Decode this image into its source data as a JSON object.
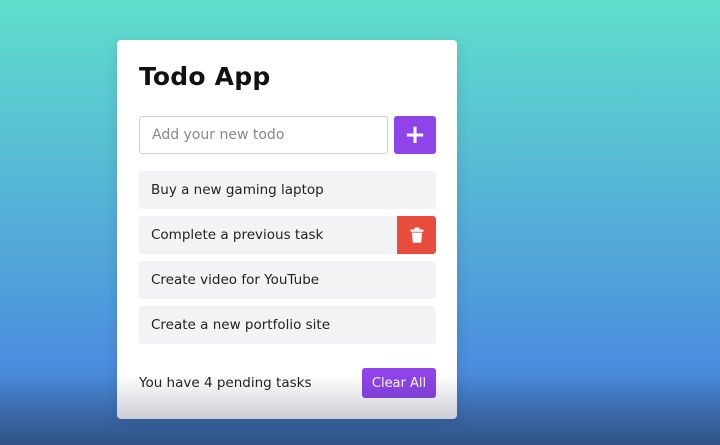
{
  "app": {
    "title": "Todo App"
  },
  "input": {
    "placeholder": "Add your new todo",
    "value": "",
    "add_label": "+"
  },
  "todos": [
    {
      "text": "Buy a new gaming laptop",
      "show_delete": false
    },
    {
      "text": "Complete a previous task",
      "show_delete": true
    },
    {
      "text": "Create video for YouTube",
      "show_delete": false
    },
    {
      "text": "Create a new portfolio site",
      "show_delete": false
    }
  ],
  "footer": {
    "pending_text": "You have 4 pending tasks",
    "clear_label": "Clear All"
  },
  "icons": {
    "add": "plus-icon",
    "delete": "trash-icon"
  },
  "colors": {
    "accent": "#8e44e8",
    "danger": "#e74c3c",
    "item_background": "#f3f2f4",
    "background_top": "#5fdfcb",
    "background_bottom": "#4b8ddf"
  }
}
